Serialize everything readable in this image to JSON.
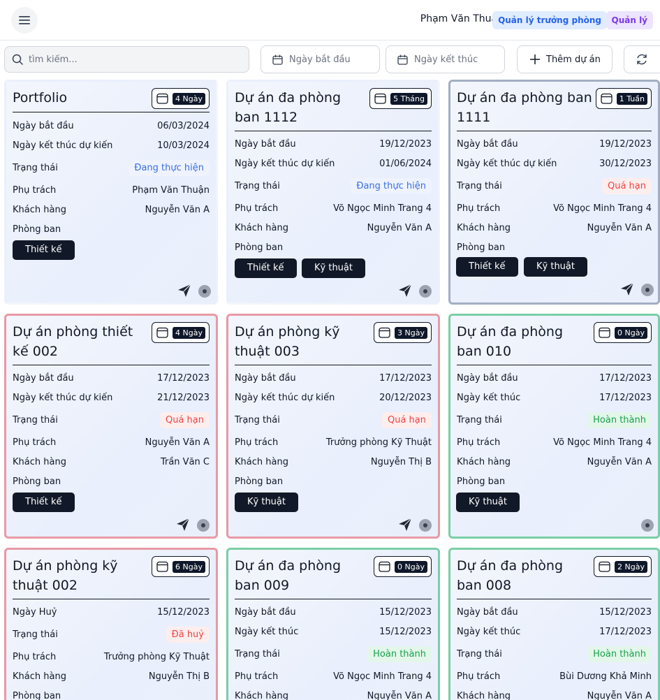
{
  "header": {
    "user_name": "Phạm Văn Thuận",
    "roles": [
      "Quản lý trưởng phòng",
      "Quản lý"
    ]
  },
  "toolbar": {
    "search_placeholder": "tìm kiếm...",
    "start_date_label": "Ngày bắt đầu",
    "end_date_label": "Ngày kết thúc",
    "add_label": "Thêm dự án"
  },
  "labels": {
    "start": "Ngày bắt đầu",
    "end_expected": "Ngày kết thúc dự kiến",
    "end": "Ngày kết thúc",
    "cancelled": "Ngày Huỷ",
    "status": "Trạng thái",
    "owner": "Phụ trách",
    "customer": "Khách hàng",
    "dept": "Phòng ban"
  },
  "cards": [
    {
      "title": "Portfolio",
      "duration": "4 Ngày",
      "start": "06/03/2024",
      "end": "10/03/2024",
      "status": "Đang thực hiện",
      "owner": "Phạm Văn Thuận",
      "customer": "Nguyễn Văn A",
      "depts": [
        "Thiết kế"
      ]
    },
    {
      "title": "Dự án đa phòng ban 1112",
      "duration": "5 Tháng",
      "start": "19/12/2023",
      "end": "01/06/2024",
      "status": "Đang thực hiện",
      "owner": "Võ Ngọc Minh Trang 4",
      "customer": "Nguyễn Văn A",
      "depts": [
        "Thiết kế",
        "Kỹ thuật"
      ]
    },
    {
      "title": "Dự án đa phòng ban 1111",
      "duration": "1 Tuần",
      "start": "19/12/2023",
      "end": "30/12/2023",
      "status": "Quá hạn",
      "owner": "Võ Ngọc Minh Trang 4",
      "customer": "Nguyễn Văn A",
      "depts": [
        "Thiết kế",
        "Kỹ thuật"
      ]
    },
    {
      "title": "Dự án phòng thiết kế 002",
      "duration": "4 Ngày",
      "start": "17/12/2023",
      "end": "21/12/2023",
      "status": "Quá hạn",
      "owner": "Nguyễn Văn A",
      "customer": "Trần Văn C",
      "depts": [
        "Thiết kế"
      ]
    },
    {
      "title": "Dự án phòng kỹ thuật 003",
      "duration": "3 Ngày",
      "start": "17/12/2023",
      "end": "20/12/2023",
      "status": "Quá hạn",
      "owner": "Trưởng phòng Kỹ Thuật",
      "customer": "Nguyễn Thị B",
      "depts": [
        "Kỹ thuật"
      ]
    },
    {
      "title": "Dự án đa phòng ban 010",
      "duration": "0 Ngày",
      "start": "17/12/2023",
      "end": "17/12/2023",
      "status": "Hoàn thành",
      "owner": "Võ Ngọc Minh Trang 4",
      "customer": "Nguyễn Văn A",
      "depts": [
        "Kỹ thuật"
      ]
    },
    {
      "title": "Dự án phòng kỹ thuật 002",
      "duration": "6 Ngày",
      "cancel_date": "15/12/2023",
      "status": "Đã huỷ",
      "owner": "Trưởng phòng Kỹ Thuật",
      "customer": "Nguyễn Thị B"
    },
    {
      "title": "Dự án đa phòng ban 009",
      "duration": "0 Ngày",
      "start": "15/12/2023",
      "end": "15/12/2023",
      "status": "Hoàn thành",
      "owner": "Võ Ngọc Minh Trang 4",
      "customer": "Nguyễn Văn A"
    },
    {
      "title": "Dự án đa phòng ban 008",
      "duration": "2 Ngày",
      "start": "15/12/2023",
      "end": "17/12/2023",
      "status": "Hoàn thành",
      "owner": "Bùi Dương Khả Minh",
      "customer": "Nguyễn Văn A"
    }
  ]
}
